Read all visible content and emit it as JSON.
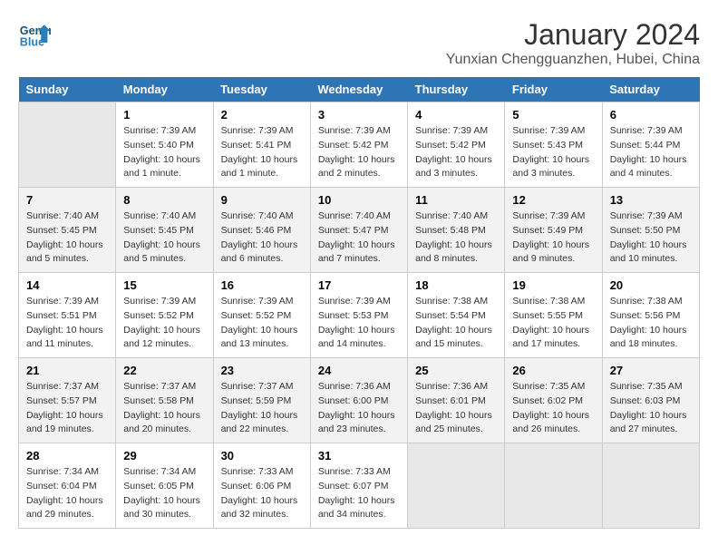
{
  "header": {
    "logo_line1": "General",
    "logo_line2": "Blue",
    "title": "January 2024",
    "subtitle": "Yunxian Chengguanzhen, Hubei, China"
  },
  "days_of_week": [
    "Sunday",
    "Monday",
    "Tuesday",
    "Wednesday",
    "Thursday",
    "Friday",
    "Saturday"
  ],
  "weeks": [
    [
      {
        "day": "",
        "empty": true
      },
      {
        "day": "1",
        "sunrise": "7:39 AM",
        "sunset": "5:40 PM",
        "daylight": "10 hours and 1 minute."
      },
      {
        "day": "2",
        "sunrise": "7:39 AM",
        "sunset": "5:41 PM",
        "daylight": "10 hours and 1 minute."
      },
      {
        "day": "3",
        "sunrise": "7:39 AM",
        "sunset": "5:42 PM",
        "daylight": "10 hours and 2 minutes."
      },
      {
        "day": "4",
        "sunrise": "7:39 AM",
        "sunset": "5:42 PM",
        "daylight": "10 hours and 3 minutes."
      },
      {
        "day": "5",
        "sunrise": "7:39 AM",
        "sunset": "5:43 PM",
        "daylight": "10 hours and 3 minutes."
      },
      {
        "day": "6",
        "sunrise": "7:39 AM",
        "sunset": "5:44 PM",
        "daylight": "10 hours and 4 minutes."
      }
    ],
    [
      {
        "day": "7",
        "sunrise": "7:40 AM",
        "sunset": "5:45 PM",
        "daylight": "10 hours and 5 minutes."
      },
      {
        "day": "8",
        "sunrise": "7:40 AM",
        "sunset": "5:45 PM",
        "daylight": "10 hours and 5 minutes."
      },
      {
        "day": "9",
        "sunrise": "7:40 AM",
        "sunset": "5:46 PM",
        "daylight": "10 hours and 6 minutes."
      },
      {
        "day": "10",
        "sunrise": "7:40 AM",
        "sunset": "5:47 PM",
        "daylight": "10 hours and 7 minutes."
      },
      {
        "day": "11",
        "sunrise": "7:40 AM",
        "sunset": "5:48 PM",
        "daylight": "10 hours and 8 minutes."
      },
      {
        "day": "12",
        "sunrise": "7:39 AM",
        "sunset": "5:49 PM",
        "daylight": "10 hours and 9 minutes."
      },
      {
        "day": "13",
        "sunrise": "7:39 AM",
        "sunset": "5:50 PM",
        "daylight": "10 hours and 10 minutes."
      }
    ],
    [
      {
        "day": "14",
        "sunrise": "7:39 AM",
        "sunset": "5:51 PM",
        "daylight": "10 hours and 11 minutes."
      },
      {
        "day": "15",
        "sunrise": "7:39 AM",
        "sunset": "5:52 PM",
        "daylight": "10 hours and 12 minutes."
      },
      {
        "day": "16",
        "sunrise": "7:39 AM",
        "sunset": "5:52 PM",
        "daylight": "10 hours and 13 minutes."
      },
      {
        "day": "17",
        "sunrise": "7:39 AM",
        "sunset": "5:53 PM",
        "daylight": "10 hours and 14 minutes."
      },
      {
        "day": "18",
        "sunrise": "7:38 AM",
        "sunset": "5:54 PM",
        "daylight": "10 hours and 15 minutes."
      },
      {
        "day": "19",
        "sunrise": "7:38 AM",
        "sunset": "5:55 PM",
        "daylight": "10 hours and 17 minutes."
      },
      {
        "day": "20",
        "sunrise": "7:38 AM",
        "sunset": "5:56 PM",
        "daylight": "10 hours and 18 minutes."
      }
    ],
    [
      {
        "day": "21",
        "sunrise": "7:37 AM",
        "sunset": "5:57 PM",
        "daylight": "10 hours and 19 minutes."
      },
      {
        "day": "22",
        "sunrise": "7:37 AM",
        "sunset": "5:58 PM",
        "daylight": "10 hours and 20 minutes."
      },
      {
        "day": "23",
        "sunrise": "7:37 AM",
        "sunset": "5:59 PM",
        "daylight": "10 hours and 22 minutes."
      },
      {
        "day": "24",
        "sunrise": "7:36 AM",
        "sunset": "6:00 PM",
        "daylight": "10 hours and 23 minutes."
      },
      {
        "day": "25",
        "sunrise": "7:36 AM",
        "sunset": "6:01 PM",
        "daylight": "10 hours and 25 minutes."
      },
      {
        "day": "26",
        "sunrise": "7:35 AM",
        "sunset": "6:02 PM",
        "daylight": "10 hours and 26 minutes."
      },
      {
        "day": "27",
        "sunrise": "7:35 AM",
        "sunset": "6:03 PM",
        "daylight": "10 hours and 27 minutes."
      }
    ],
    [
      {
        "day": "28",
        "sunrise": "7:34 AM",
        "sunset": "6:04 PM",
        "daylight": "10 hours and 29 minutes."
      },
      {
        "day": "29",
        "sunrise": "7:34 AM",
        "sunset": "6:05 PM",
        "daylight": "10 hours and 30 minutes."
      },
      {
        "day": "30",
        "sunrise": "7:33 AM",
        "sunset": "6:06 PM",
        "daylight": "10 hours and 32 minutes."
      },
      {
        "day": "31",
        "sunrise": "7:33 AM",
        "sunset": "6:07 PM",
        "daylight": "10 hours and 34 minutes."
      },
      {
        "day": "",
        "empty": true
      },
      {
        "day": "",
        "empty": true
      },
      {
        "day": "",
        "empty": true
      }
    ]
  ]
}
